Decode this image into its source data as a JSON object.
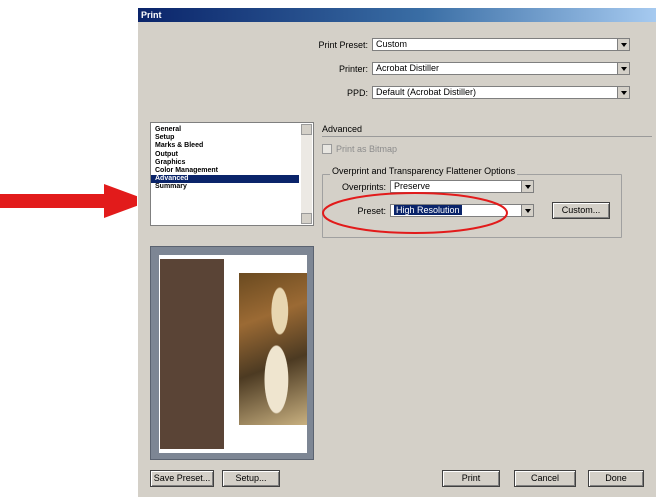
{
  "window": {
    "title": "Print"
  },
  "form": {
    "print_preset_label": "Print Preset:",
    "print_preset_value": "Custom",
    "printer_label": "Printer:",
    "printer_value": "Acrobat Distiller",
    "ppd_label": "PPD:",
    "ppd_value": "Default (Acrobat Distiller)"
  },
  "sidebar": {
    "items": [
      {
        "label": "General"
      },
      {
        "label": "Setup"
      },
      {
        "label": "Marks & Bleed"
      },
      {
        "label": "Output"
      },
      {
        "label": "Graphics"
      },
      {
        "label": "Color Management"
      },
      {
        "label": "Advanced",
        "selected": true
      },
      {
        "label": "Summary"
      }
    ]
  },
  "advanced": {
    "section_title": "Advanced",
    "print_as_bitmap_label": "Print as Bitmap",
    "group_title": "Overprint and Transparency Flattener Options",
    "overprints_label": "Overprints:",
    "overprints_value": "Preserve",
    "preset_label": "Preset:",
    "preset_value": "High Resolution",
    "custom_button": "Custom..."
  },
  "buttons": {
    "save_preset": "Save Preset...",
    "setup": "Setup...",
    "print": "Print",
    "cancel": "Cancel",
    "done": "Done"
  },
  "colors": {
    "annotation_red": "#e21b1b",
    "selection_blue": "#0a246a",
    "dialog_gray": "#d4d0c8"
  }
}
